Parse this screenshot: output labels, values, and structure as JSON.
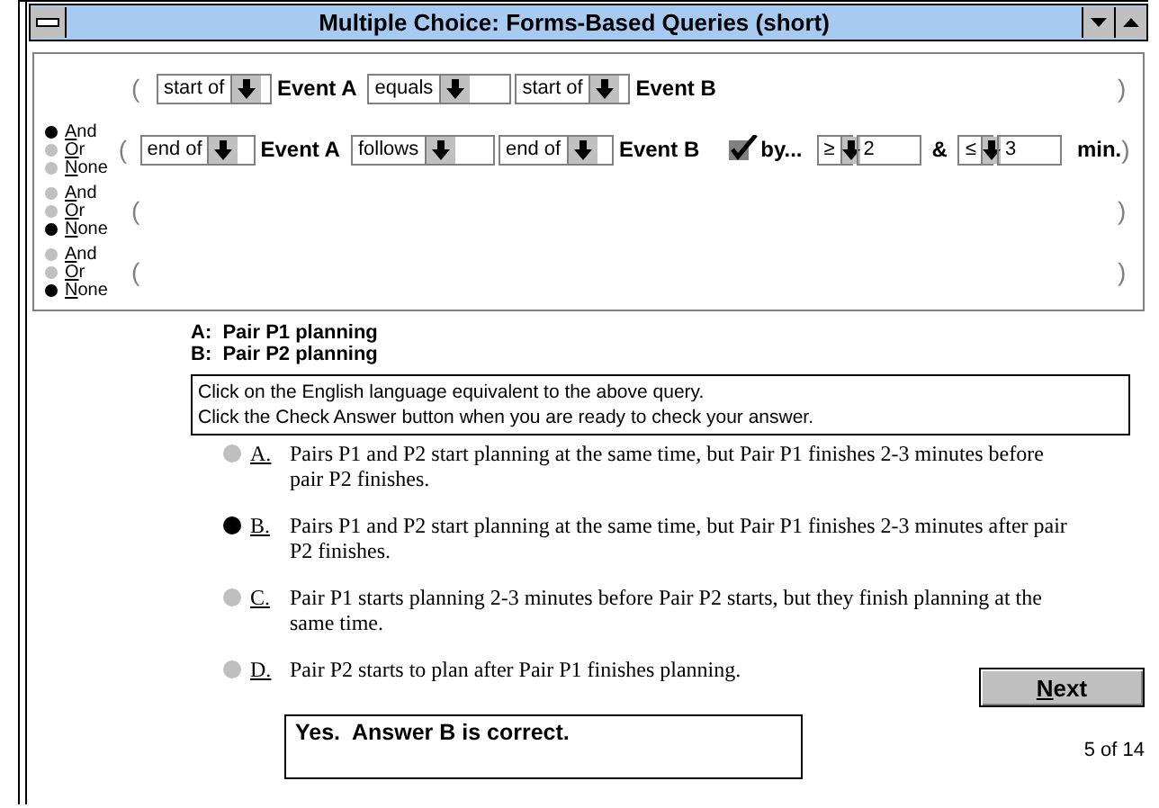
{
  "window": {
    "title": "Multiple Choice:  Forms-Based Queries (short)"
  },
  "query_rows": [
    {
      "open": "(",
      "close": ")",
      "condition": {
        "from": "start of",
        "event_a": "Event A",
        "relation": "equals",
        "to": "start of",
        "event_b": "Event B"
      }
    },
    {
      "connectors": [
        {
          "label": "And",
          "selected": true
        },
        {
          "label": "Or",
          "selected": false
        },
        {
          "label": "None",
          "selected": false
        }
      ],
      "open": "(",
      "close": ")",
      "condition": {
        "from": "end of",
        "event_a": "Event A",
        "relation": "follows",
        "to": "end of",
        "event_b": "Event B",
        "by": {
          "label": "by...",
          "checked": true,
          "low_op": "≥",
          "low_value": "2",
          "joiner": "&",
          "high_op": "≤",
          "high_value": "3",
          "unit": "min."
        }
      }
    },
    {
      "connectors": [
        {
          "label": "And",
          "selected": false
        },
        {
          "label": "Or",
          "selected": false
        },
        {
          "label": "None",
          "selected": true
        }
      ],
      "open": "(",
      "close": ")"
    },
    {
      "connectors": [
        {
          "label": "And",
          "selected": false
        },
        {
          "label": "Or",
          "selected": false
        },
        {
          "label": "None",
          "selected": true
        }
      ],
      "open": "(",
      "close": ")"
    }
  ],
  "legend": [
    "A:  Pair P1 planning",
    "B:  Pair P2 planning"
  ],
  "instructions": [
    "Click on the English language equivalent to the above query.",
    "Click the Check Answer button when you are ready to check your answer."
  ],
  "options": [
    {
      "letter": "A.",
      "text": "Pairs P1 and P2 start planning at the same time, but Pair P1 finishes 2-3 minutes before pair P2 finishes.",
      "selected": false
    },
    {
      "letter": "B.",
      "text": "Pairs P1 and P2 start planning at the same time, but Pair P1 finishes 2-3 minutes after pair P2 finishes.",
      "selected": true
    },
    {
      "letter": "C.",
      "text": "Pair P1 starts planning 2-3 minutes before Pair P2 starts, but they finish planning at the same time.",
      "selected": false
    },
    {
      "letter": "D.",
      "text": "Pair P2 starts to plan after Pair P1 finishes planning.",
      "selected": false
    }
  ],
  "feedback": "Yes.  Answer B is correct.",
  "next_button": "Next",
  "progress": "5 of 14"
}
